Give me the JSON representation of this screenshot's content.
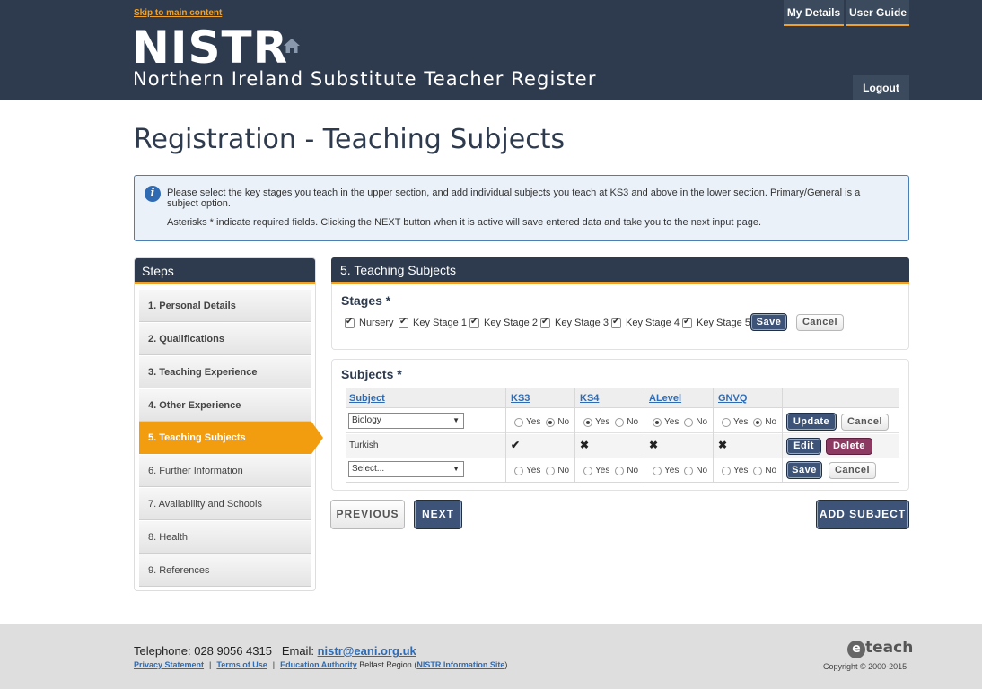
{
  "header": {
    "skip_link": "Skip to main content",
    "brand": "NISTR",
    "brand_sub": "Northern Ireland Substitute Teacher Register",
    "my_details": "My Details",
    "user_guide": "User Guide",
    "logout": "Logout"
  },
  "page_title": "Registration - Teaching Subjects",
  "info": {
    "line1": "Please select the key stages you teach in the upper section, and add individual subjects you teach at KS3 and above in the lower section. Primary/General is a subject option.",
    "line2": "Asterisks * indicate required fields. Clicking the NEXT button when it is active will save entered data and take you to the next input page."
  },
  "steps": {
    "title": "Steps",
    "items": [
      {
        "label": "1. Personal Details"
      },
      {
        "label": "2. Qualifications"
      },
      {
        "label": "3. Teaching Experience"
      },
      {
        "label": "4. Other Experience"
      },
      {
        "label": "5. Teaching Subjects"
      },
      {
        "label": "6. Further Information"
      },
      {
        "label": "7. Availability and Schools"
      },
      {
        "label": "8. Health"
      },
      {
        "label": "9. References"
      }
    ]
  },
  "main": {
    "title": "5. Teaching Subjects",
    "stages": {
      "title": "Stages *",
      "items": [
        "Nursery",
        "Key Stage 1",
        "Key Stage 2",
        "Key Stage 3",
        "Key Stage 4",
        "Key Stage 5"
      ],
      "save": "Save",
      "cancel": "Cancel"
    },
    "subjects": {
      "title": "Subjects *",
      "columns": [
        "Subject",
        "KS3",
        "KS4",
        "ALevel",
        "GNVQ"
      ],
      "yes": "Yes",
      "no": "No",
      "row1": {
        "subject": "Biology",
        "update": "Update",
        "cancel": "Cancel"
      },
      "row2": {
        "subject": "Turkish",
        "edit": "Edit",
        "delete": "Delete"
      },
      "row3": {
        "subject": "Select...",
        "save": "Save",
        "cancel": "Cancel"
      }
    },
    "previous": "PREVIOUS",
    "next": "NEXT",
    "add_subject": "ADD SUBJECT"
  },
  "footer": {
    "telephone": "Telephone: 028 9056 4315",
    "email_label": "Email:",
    "email": "nistr@eani.org.uk",
    "privacy": "Privacy Statement",
    "terms": "Terms of Use",
    "ea": "Education Authority",
    "region": "Belfast Region (",
    "site": "NISTR Information Site",
    "close_paren": ")",
    "eteach": "teach",
    "eteach_e": "e",
    "copyright": "Copyright © 2000-2015"
  }
}
